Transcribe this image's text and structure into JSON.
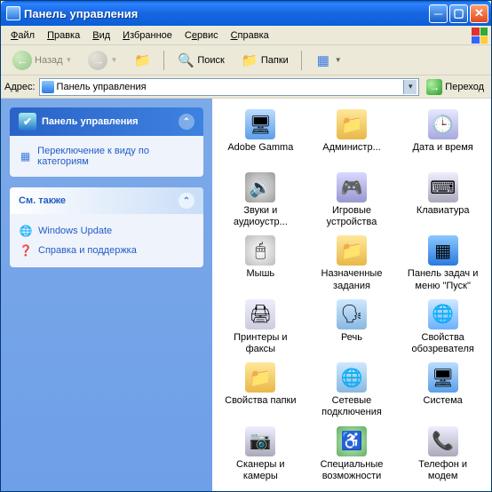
{
  "window": {
    "title": "Панель управления"
  },
  "menu": {
    "file": "Файл",
    "edit": "Правка",
    "view": "Вид",
    "fav": "Избранное",
    "tools": "Сервис",
    "help": "Справка"
  },
  "toolbar": {
    "back": "Назад",
    "search": "Поиск",
    "folders": "Папки"
  },
  "address": {
    "label": "Адрес:",
    "value": "Панель управления",
    "go": "Переход"
  },
  "sidebar": {
    "panel1": {
      "title": "Панель управления",
      "switch": "Переключение к виду по категориям"
    },
    "panel2": {
      "title": "См. также",
      "links": [
        "Windows Update",
        "Справка и поддержка"
      ]
    }
  },
  "icons": [
    {
      "label": "Adobe Gamma",
      "bg": "linear-gradient(#bcdcff,#5aa0e8)",
      "glyph": "🖥"
    },
    {
      "label": "Администр...",
      "bg": "linear-gradient(#ffe89a,#e8b848)",
      "glyph": "📁"
    },
    {
      "label": "Дата и время",
      "bg": "linear-gradient(#e8e8ff,#a8a8e0)",
      "glyph": "🕒"
    },
    {
      "label": "Звуки и аудиоустр...",
      "bg": "radial-gradient(circle,#eee,#999)",
      "glyph": "🔊"
    },
    {
      "label": "Игровые устройства",
      "bg": "linear-gradient(#d8d8ff,#9898d0)",
      "glyph": "🎮"
    },
    {
      "label": "Клавиатура",
      "bg": "linear-gradient(#eef,#aab)",
      "glyph": "⌨"
    },
    {
      "label": "Мышь",
      "bg": "radial-gradient(circle,#fff,#bbb)",
      "glyph": "🖱"
    },
    {
      "label": "Назначенные задания",
      "bg": "linear-gradient(#ffe89a,#e8b848)",
      "glyph": "📁"
    },
    {
      "label": "Панель задач и меню \"Пуск\"",
      "bg": "linear-gradient(#8cc8ff,#2a7ae0)",
      "glyph": "▦"
    },
    {
      "label": "Принтеры и факсы",
      "bg": "linear-gradient(#eef,#ccd)",
      "glyph": "🖨"
    },
    {
      "label": "Речь",
      "bg": "linear-gradient(#cfe8ff,#88b8e0)",
      "glyph": "🗣"
    },
    {
      "label": "Свойства обозревателя",
      "bg": "linear-gradient(#cfe8ff,#6cb0ff)",
      "glyph": "🌐"
    },
    {
      "label": "Свойства папки",
      "bg": "linear-gradient(#ffe89a,#e8b848)",
      "glyph": "📁"
    },
    {
      "label": "Сетевые подключения",
      "bg": "linear-gradient(#cfe8ff,#88b8e0)",
      "glyph": "🌐"
    },
    {
      "label": "Система",
      "bg": "linear-gradient(#bcdcff,#5aa0e8)",
      "glyph": "🖥"
    },
    {
      "label": "Сканеры и камеры",
      "bg": "linear-gradient(#eef,#aab)",
      "glyph": "📷"
    },
    {
      "label": "Специальные возможности",
      "bg": "radial-gradient(circle,#d0f0d0,#60b060)",
      "glyph": "♿"
    },
    {
      "label": "Телефон и модем",
      "bg": "linear-gradient(#eef,#aab)",
      "glyph": "📞"
    }
  ]
}
